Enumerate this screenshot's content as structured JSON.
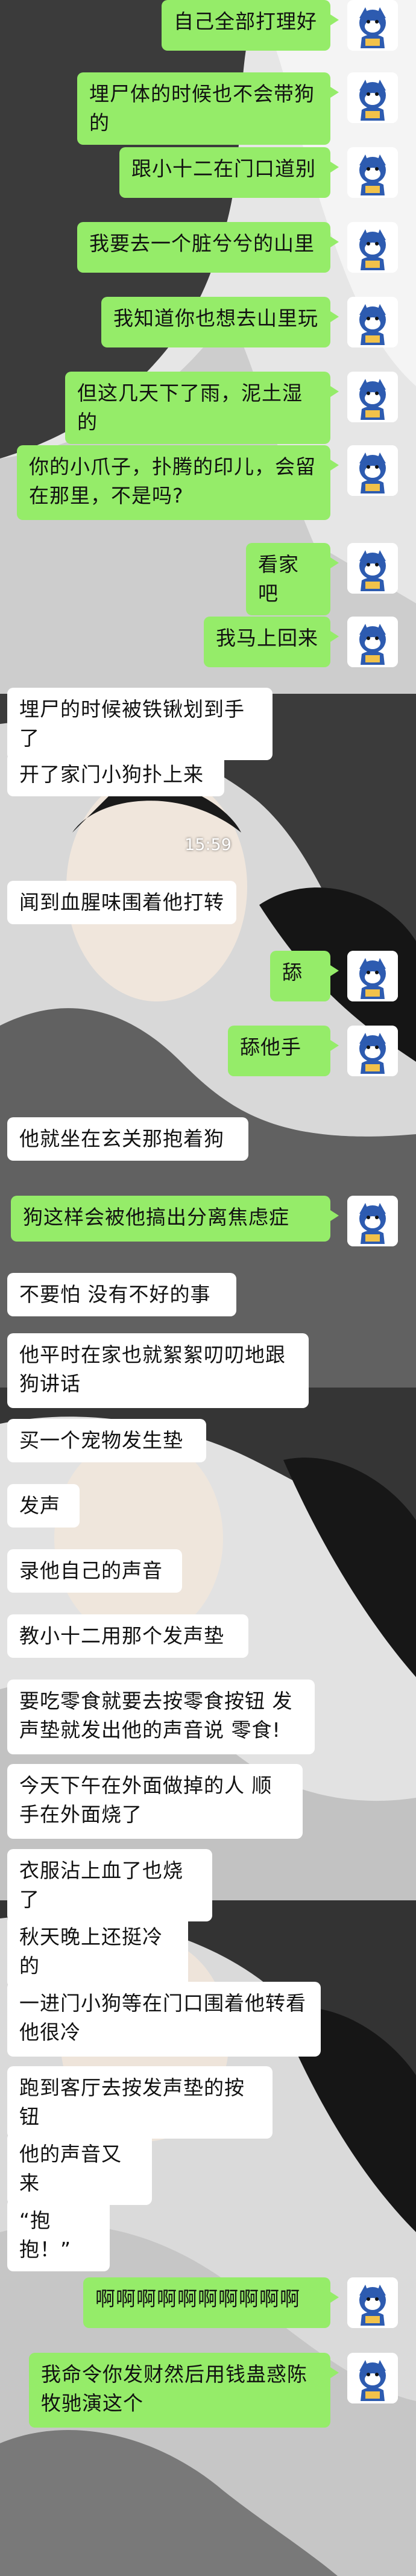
{
  "timestamp": "15:59",
  "colors": {
    "outgoing_bubble": "#95ec69",
    "incoming_bubble": "#ffffff",
    "avatar_blue": "#2d5bb0"
  },
  "messages": [
    {
      "dir": "out",
      "text": "自己全部打理好"
    },
    {
      "dir": "out",
      "text": "埋尸体的时候也不会带狗的"
    },
    {
      "dir": "out",
      "text": "跟小十二在门口道别"
    },
    {
      "dir": "out",
      "text": "我要去一个脏兮兮的山里"
    },
    {
      "dir": "out",
      "text": "我知道你也想去山里玩"
    },
    {
      "dir": "out",
      "text": "但这几天下了雨，泥土湿的"
    },
    {
      "dir": "out",
      "text": "你的小爪子，扑腾的印儿，会留在那里，不是吗?"
    },
    {
      "dir": "out",
      "text": "看家吧"
    },
    {
      "dir": "out",
      "text": "我马上回来"
    },
    {
      "dir": "in",
      "text": "埋尸的时候被铁锹划到手了"
    },
    {
      "dir": "in",
      "text": "开了家门小狗扑上来"
    },
    {
      "dir": "in",
      "text": "闻到血腥味围着他打转"
    },
    {
      "dir": "out",
      "text": "舔"
    },
    {
      "dir": "out",
      "text": "舔他手"
    },
    {
      "dir": "in",
      "text": "他就坐在玄关那抱着狗"
    },
    {
      "dir": "out",
      "text": "狗这样会被他搞出分离焦虑症"
    },
    {
      "dir": "in",
      "text": "不要怕 没有不好的事"
    },
    {
      "dir": "in",
      "text": "他平时在家也就絮絮叨叨地跟狗讲话"
    },
    {
      "dir": "in",
      "text": "买一个宠物发生垫"
    },
    {
      "dir": "in",
      "text": "发声"
    },
    {
      "dir": "in",
      "text": "录他自己的声音"
    },
    {
      "dir": "in",
      "text": "教小十二用那个发声垫"
    },
    {
      "dir": "in",
      "text": "要吃零食就要去按零食按钮 发声垫就发出他的声音说 零食!"
    },
    {
      "dir": "in",
      "text": "今天下午在外面做掉的人 顺手在外面烧了"
    },
    {
      "dir": "in",
      "text": "衣服沾上血了也烧了"
    },
    {
      "dir": "in",
      "text": "秋天晚上还挺冷的"
    },
    {
      "dir": "in",
      "text": "一进门小狗等在门口围着他转看他很冷"
    },
    {
      "dir": "in",
      "text": "跑到客厅去按发声垫的按钮"
    },
    {
      "dir": "in",
      "text": "他的声音又来"
    },
    {
      "dir": "in",
      "text": "“抱抱！”"
    },
    {
      "dir": "out",
      "text": "啊啊啊啊啊啊啊啊啊啊"
    },
    {
      "dir": "out",
      "text": "我命令你发财然后用钱蛊惑陈牧驰演这个"
    }
  ]
}
